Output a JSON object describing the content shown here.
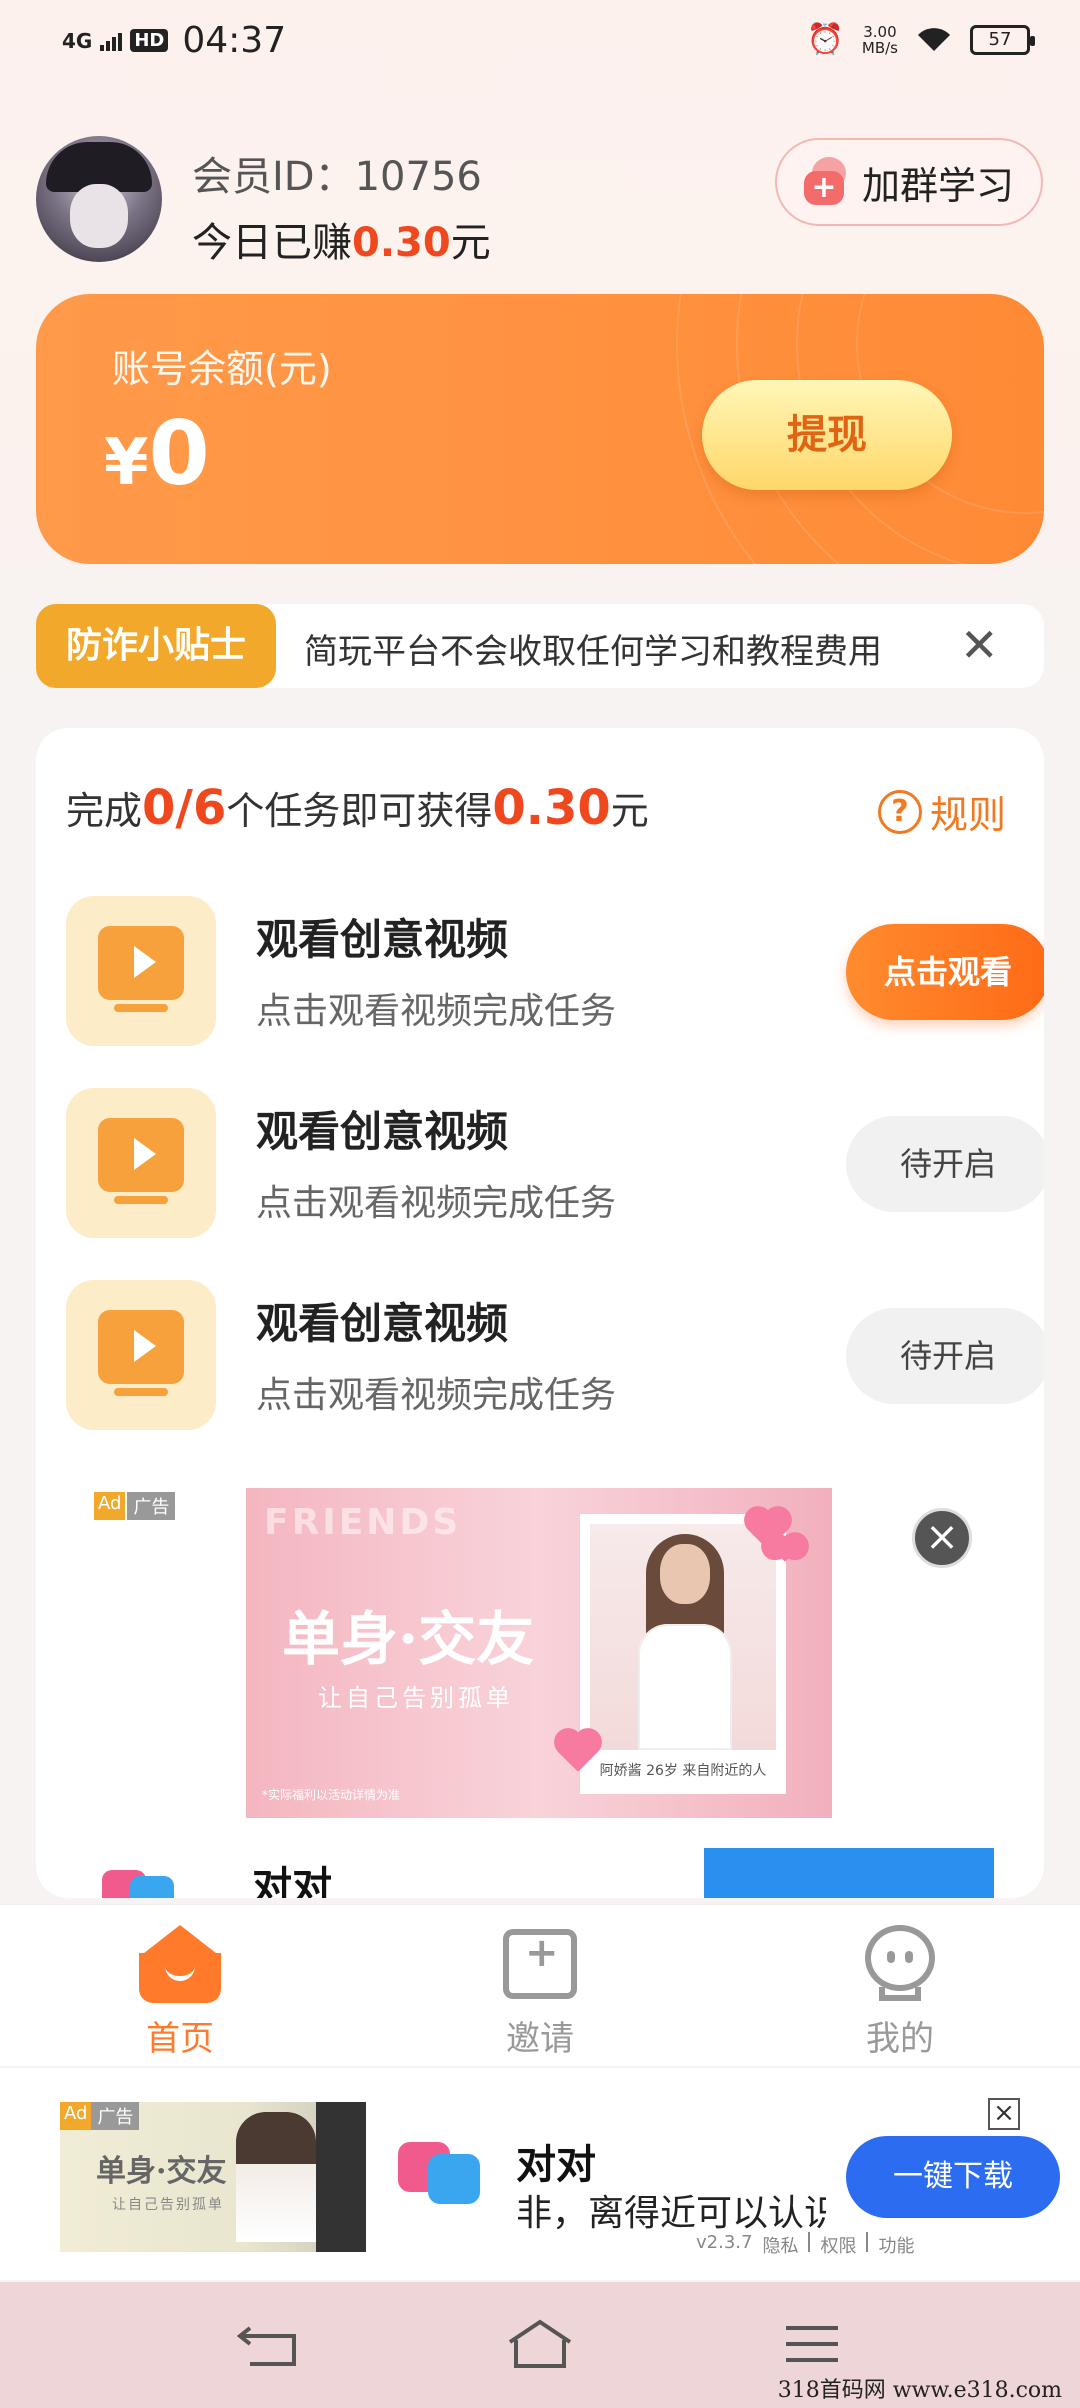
{
  "status_bar": {
    "network": "4G",
    "hd": "HD",
    "time": "04:37",
    "speed_value": "3.00",
    "speed_unit": "MB/s",
    "battery": "57"
  },
  "header": {
    "member_id": "会员ID：10756",
    "earned_prefix": "今日已赚",
    "earned_amount": "0.30",
    "earned_suffix": "元",
    "join_group_label": "加群学习"
  },
  "balance": {
    "label": "账号余额(元)",
    "currency": "¥",
    "value": "0",
    "withdraw_label": "提现"
  },
  "tips": {
    "tag": "防诈小贴士",
    "text": "简玩平台不会收取任何学习和教程费用"
  },
  "tasks": {
    "head_prefix": "完成",
    "progress": "0/6",
    "head_middle": "个任务即可获得",
    "reward": "0.30",
    "head_suffix": "元",
    "rules_label": "规则",
    "items": [
      {
        "title": "观看创意视频",
        "subtitle": "点击观看视频完成任务",
        "button": "点击观看",
        "state": "active"
      },
      {
        "title": "观看创意视频",
        "subtitle": "点击观看视频完成任务",
        "button": "待开启",
        "state": "pending"
      },
      {
        "title": "观看创意视频",
        "subtitle": "点击观看视频完成任务",
        "button": "待开启",
        "state": "pending"
      }
    ]
  },
  "feed_ad": {
    "ad_label": "Ad",
    "ad_cn_label": "广告",
    "friends_text": "FRIENDS",
    "headline": "单身·交友",
    "subline": "让自己告别孤单",
    "fineprint": "*实际福利以活动详情为准",
    "photo_caption": "阿娇酱   26岁   来自附近的人",
    "app_name": "对对"
  },
  "bottom_nav": {
    "items": [
      {
        "label": "首页",
        "icon": "home-icon",
        "active": true
      },
      {
        "label": "邀请",
        "icon": "invite-icon",
        "active": false
      },
      {
        "label": "我的",
        "icon": "profile-icon",
        "active": false
      }
    ],
    "active_color": "#ff7a2a",
    "inactive_color": "#999999"
  },
  "bottom_ad": {
    "ad_label": "Ad",
    "ad_cn_label": "广告",
    "image_headline": "单身·交友",
    "image_sub": "让自己告别孤单",
    "app_name": "对对",
    "description": "非，离得近可以认识",
    "download_label": "一键下载",
    "version": "v2.3.7",
    "privacy": "隐私",
    "permissions": "权限",
    "features": "功能"
  },
  "watermark": "318首码网  www.e318.com"
}
